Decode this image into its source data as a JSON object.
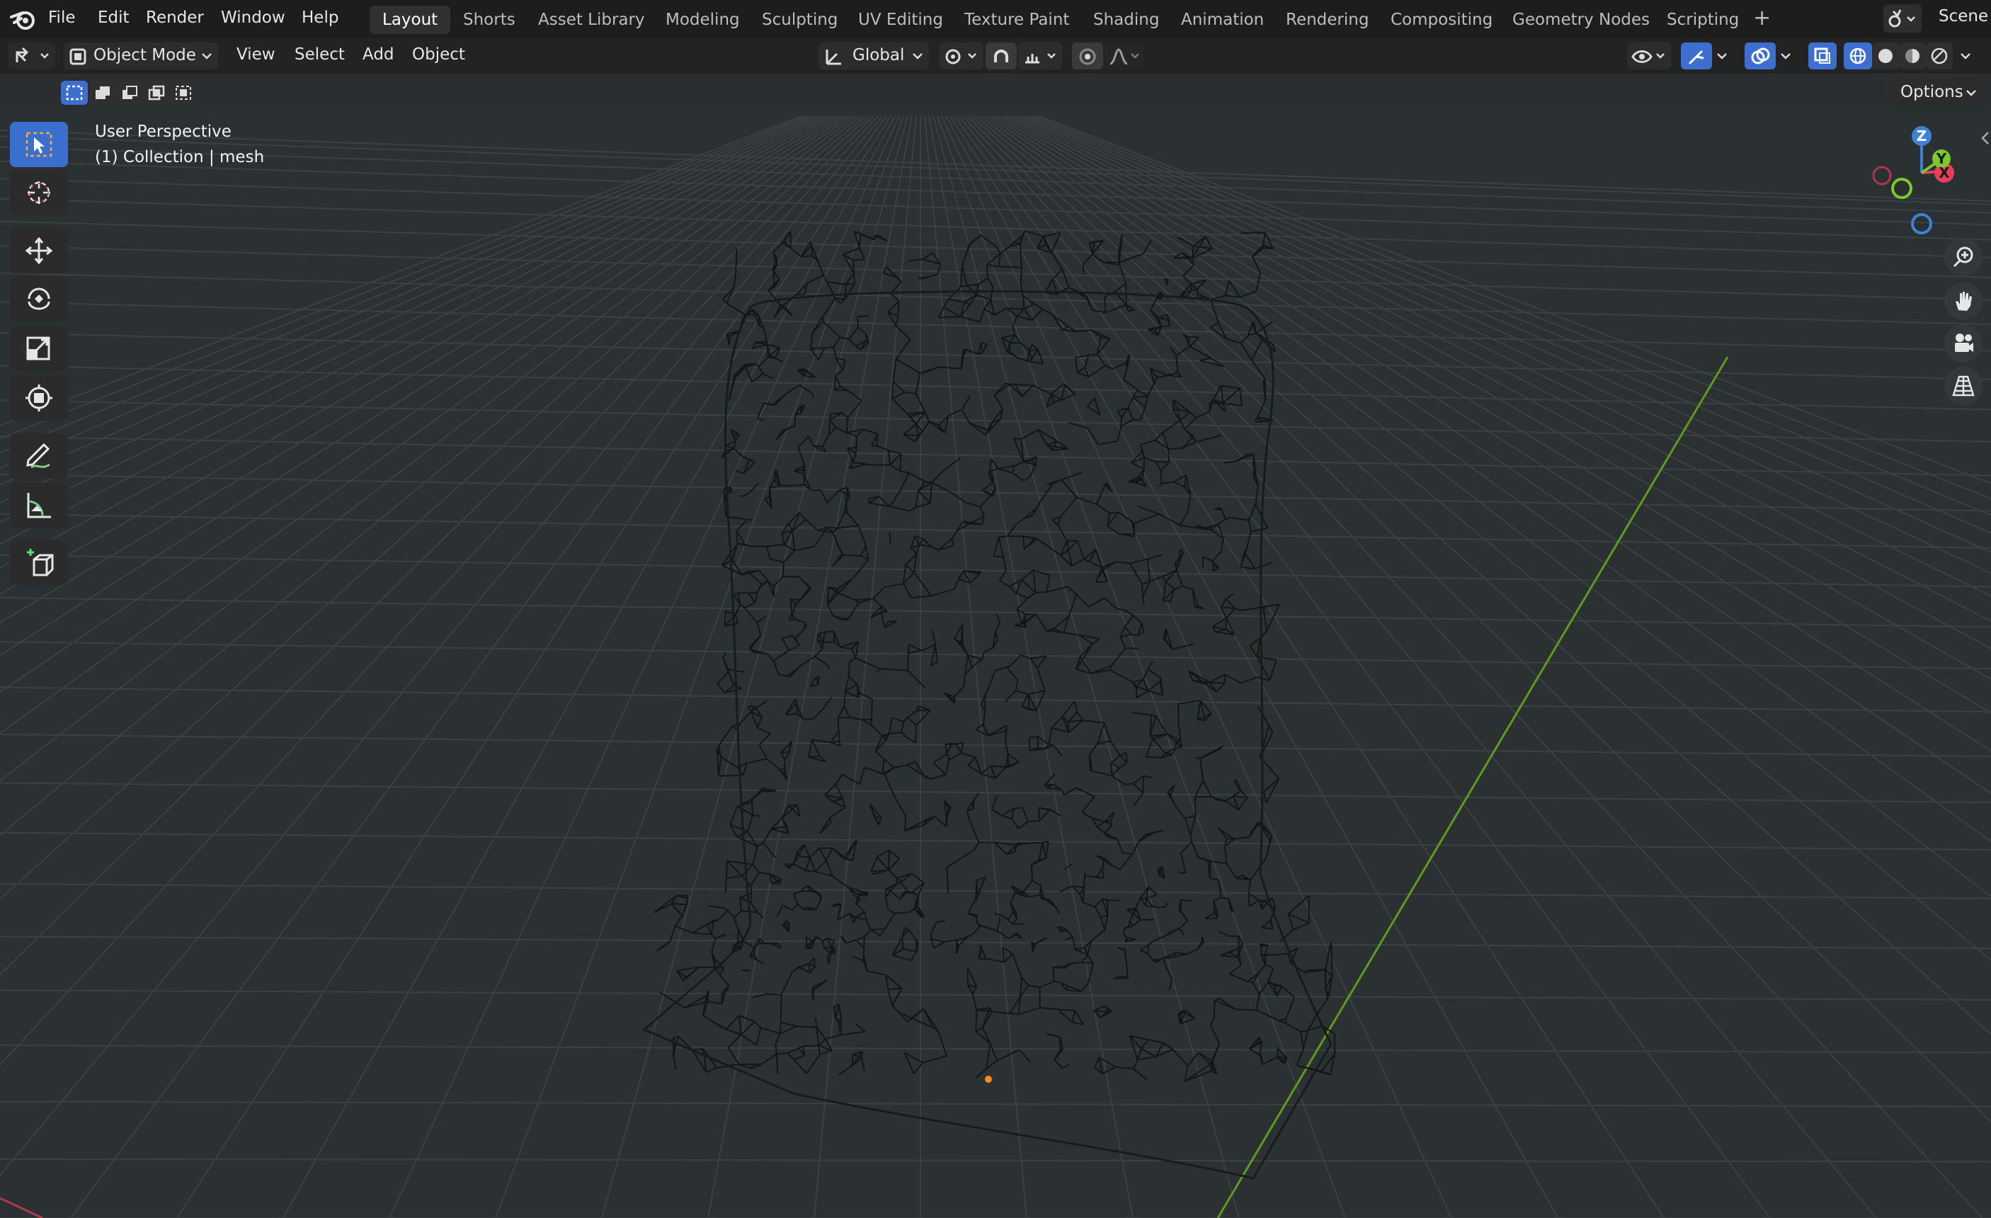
{
  "menu": {
    "items": [
      "File",
      "Edit",
      "Render",
      "Window",
      "Help"
    ]
  },
  "workspaces": {
    "tabs": [
      "Layout",
      "Shorts",
      "Asset Library",
      "Modeling",
      "Sculpting",
      "UV Editing",
      "Texture Paint",
      "Shading",
      "Animation",
      "Rendering",
      "Compositing",
      "Geometry Nodes",
      "Scripting"
    ],
    "active": "Layout",
    "add_label": "+"
  },
  "scene": {
    "label": "Scene"
  },
  "viewport_header": {
    "mode": "Object Mode",
    "menus": [
      "View",
      "Select",
      "Add",
      "Object"
    ],
    "orientation": "Global",
    "options_label": "Options"
  },
  "viewport": {
    "view_name": "User Perspective",
    "collection_info": "(1) Collection | mesh"
  },
  "gizmo": {
    "z": "Z",
    "y": "Y",
    "x": "X"
  },
  "colors": {
    "accent": "#3d6fd1",
    "x_axis": "#e8405a",
    "y_axis": "#7bc92b",
    "z_axis": "#3d82d6",
    "origin": "#ff8a1e"
  },
  "icons": {
    "blender_logo": "blender-logo-icon",
    "tools": [
      "select-box-icon",
      "cursor-icon",
      "move-icon",
      "rotate-icon",
      "scale-icon",
      "transform-icon",
      "annotate-icon",
      "measure-icon",
      "add-cube-icon"
    ],
    "nav": [
      "zoom-icon",
      "pan-hand-icon",
      "camera-icon",
      "grid-perspective-icon"
    ]
  }
}
